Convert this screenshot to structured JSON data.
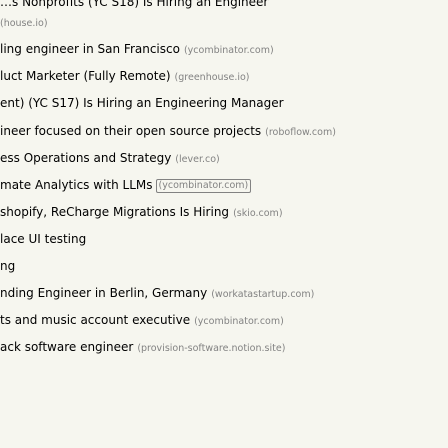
{
  "stories": [
    {
      "title": "…s Nonprofits (YC S18) Is Hiring an Engineer",
      "domain": "",
      "cut": true
    },
    {
      "title": "",
      "domain": "(house.io)",
      "cut": false
    },
    {
      "title": "ling engineer in San Francisco",
      "domain": "(ycombinator.com)",
      "cut": false
    },
    {
      "title": "luct Marketer (Fully Remote)",
      "domain": "(greenhouse.io)",
      "cut": false
    },
    {
      "title": "ent) (YC S17) Is Hiring an Engineering Manager",
      "domain": "",
      "cut": false
    },
    {
      "title": "ineer focused on their open source projects",
      "domain": "(roboflow.com)",
      "cut": false
    },
    {
      "title": "ess Operations and Strategy",
      "domain": "(lever.co)",
      "cut": false
    },
    {
      "title": "mate Analytics with LLMs",
      "domain": "(ycombinator.com)",
      "cut": false,
      "boxed": true
    },
    {
      "title": "shopify, ReCharge Migrations Is Hiring",
      "domain": "(skio.com)",
      "cut": false
    },
    {
      "title": "lace UI testing",
      "domain": "",
      "cut": false
    },
    {
      "title": "ng",
      "domain": "",
      "cut": false
    },
    {
      "title": "nding Engineer in Berlin, Germany",
      "domain": "(workatastartup.com)",
      "cut": false
    },
    {
      "title": "ts and music account executive",
      "domain": "(ycombinator.com)",
      "cut": false
    },
    {
      "title": "ack software engineer",
      "domain": "(provision-software.notion.site)",
      "cut": false
    }
  ],
  "colors": {
    "background": "#f6f6ef",
    "title": "#000000",
    "domain": "#828282"
  }
}
